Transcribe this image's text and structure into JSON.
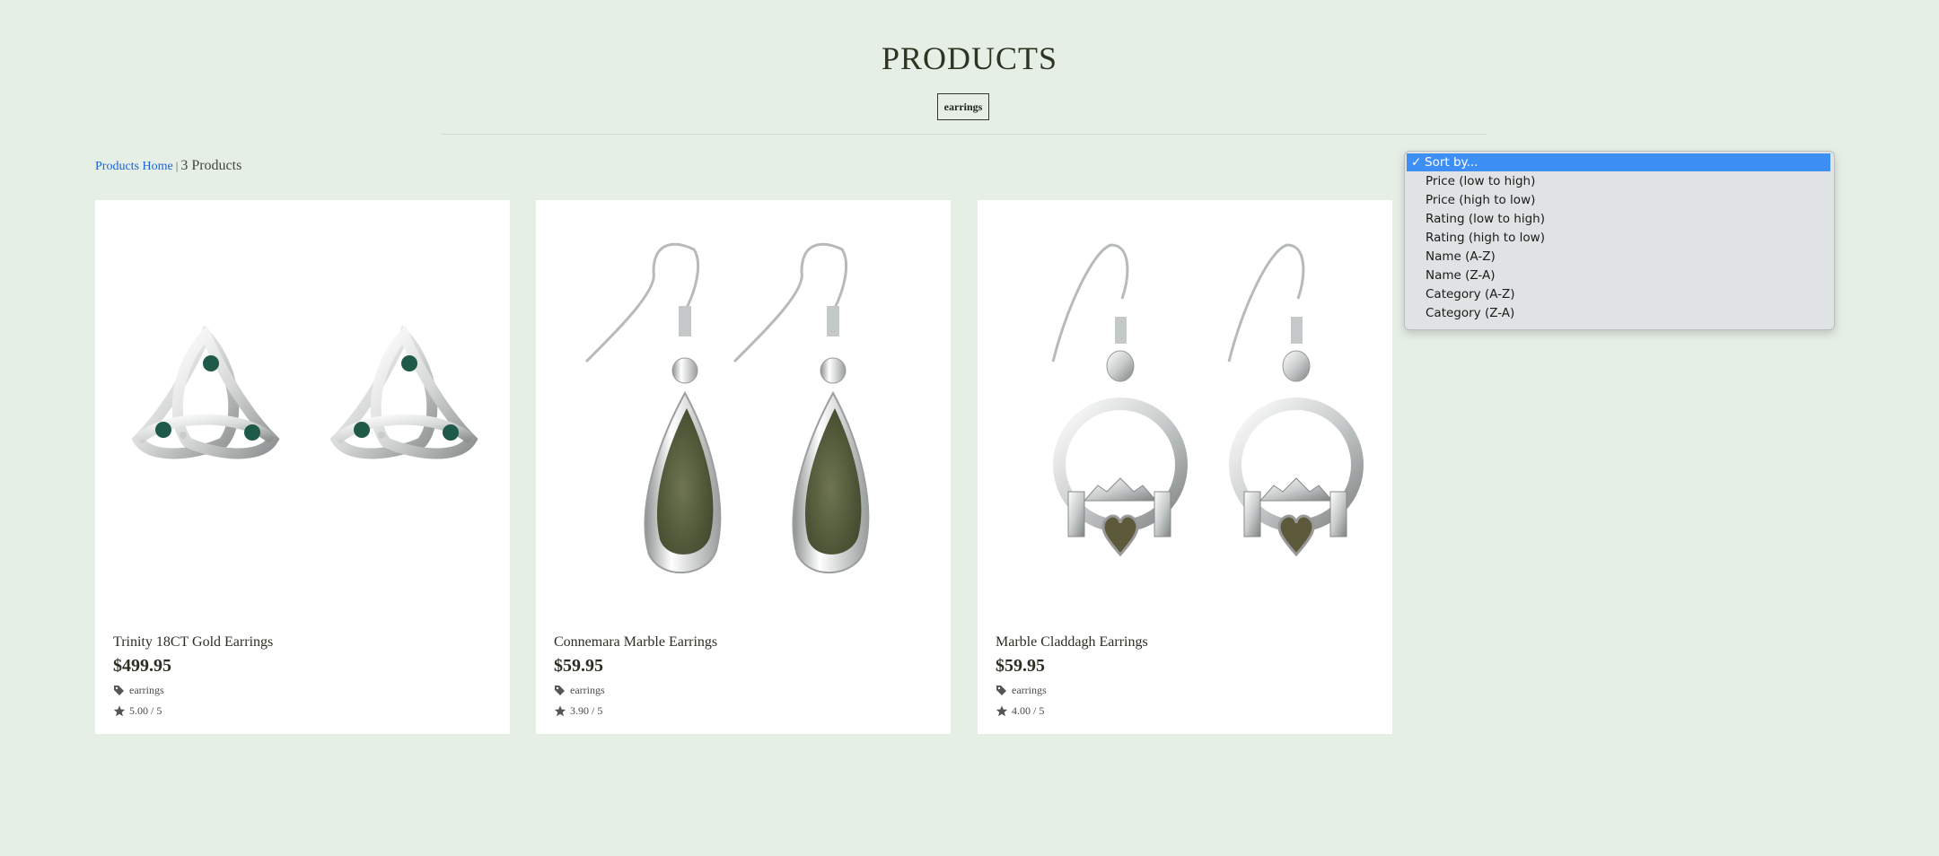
{
  "header": {
    "title": "PRODUCTS",
    "filter_chip": "earrings"
  },
  "breadcrumb": {
    "home_link": "Products Home",
    "separator": "|",
    "count": "3 Products"
  },
  "products": [
    {
      "name": "Trinity 18CT Gold Earrings",
      "price": "$499.95",
      "category": "earrings",
      "rating": "5.00 / 5"
    },
    {
      "name": "Connemara Marble Earrings",
      "price": "$59.95",
      "category": "earrings",
      "rating": "3.90 / 5"
    },
    {
      "name": "Marble Claddagh Earrings",
      "price": "$59.95",
      "category": "earrings",
      "rating": "4.00 / 5"
    }
  ],
  "sort": {
    "check": "✓",
    "options": [
      "Sort by...",
      "Price (low to high)",
      "Price (high to low)",
      "Rating (low to high)",
      "Rating (high to low)",
      "Name (A-Z)",
      "Name (Z-A)",
      "Category (A-Z)",
      "Category (Z-A)"
    ]
  },
  "colors": {
    "background": "#e6efe6",
    "link": "#1a63d6",
    "selected_option": "#3d8ef5",
    "marble_green": "#5a6340",
    "gem_green": "#1f5a48"
  },
  "icons": {
    "tag": "tag-icon",
    "rating": "star-icon",
    "check": "checkmark-icon"
  }
}
